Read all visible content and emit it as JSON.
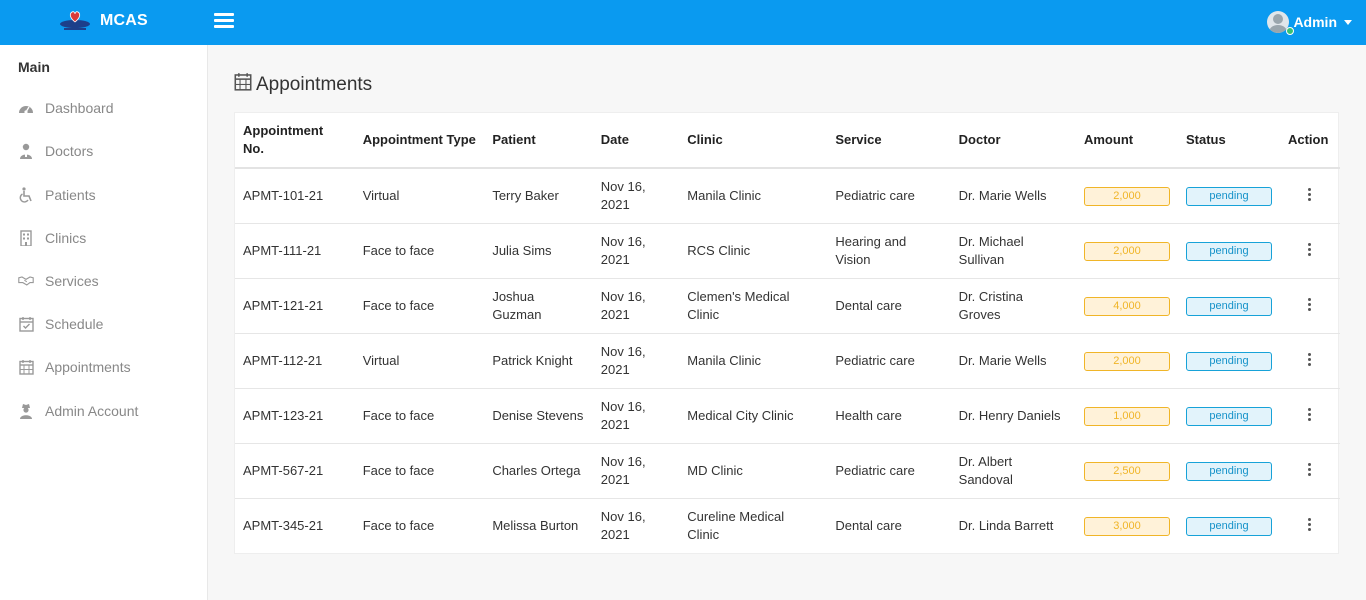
{
  "app": {
    "brand": "MCAS"
  },
  "user": {
    "name": "Admin"
  },
  "sidebar": {
    "heading": "Main",
    "items": [
      {
        "label": "Dashboard",
        "icon": "dashboard-icon"
      },
      {
        "label": "Doctors",
        "icon": "doctor-icon"
      },
      {
        "label": "Patients",
        "icon": "wheelchair-icon"
      },
      {
        "label": "Clinics",
        "icon": "building-icon"
      },
      {
        "label": "Services",
        "icon": "handshake-icon"
      },
      {
        "label": "Schedule",
        "icon": "calendar-check-icon"
      },
      {
        "label": "Appointments",
        "icon": "calendar-icon"
      },
      {
        "label": "Admin Account",
        "icon": "user-secret-icon"
      }
    ]
  },
  "page": {
    "title": "Appointments"
  },
  "table": {
    "headers": {
      "appointment_no": "Appointment No.",
      "appointment_type": "Appointment Type",
      "patient": "Patient",
      "date": "Date",
      "clinic": "Clinic",
      "service": "Service",
      "doctor": "Doctor",
      "amount": "Amount",
      "status": "Status",
      "action": "Action"
    },
    "rows": [
      {
        "appointment_no": "APMT-101-21",
        "appointment_type": "Virtual",
        "patient": "Terry Baker",
        "date": "Nov 16, 2021",
        "clinic": "Manila Clinic",
        "service": "Pediatric care",
        "doctor": "Dr. Marie Wells",
        "amount": "2,000",
        "status": "pending"
      },
      {
        "appointment_no": "APMT-111-21",
        "appointment_type": "Face to face",
        "patient": "Julia Sims",
        "date": "Nov 16, 2021",
        "clinic": "RCS Clinic",
        "service": "Hearing and Vision",
        "doctor": "Dr. Michael Sullivan",
        "amount": "2,000",
        "status": "pending"
      },
      {
        "appointment_no": "APMT-121-21",
        "appointment_type": "Face to face",
        "patient": "Joshua Guzman",
        "date": "Nov 16, 2021",
        "clinic": "Clemen's Medical Clinic",
        "service": "Dental care",
        "doctor": "Dr. Cristina Groves",
        "amount": "4,000",
        "status": "pending"
      },
      {
        "appointment_no": "APMT-112-21",
        "appointment_type": "Virtual",
        "patient": "Patrick Knight",
        "date": "Nov 16, 2021",
        "clinic": "Manila Clinic",
        "service": "Pediatric care",
        "doctor": "Dr. Marie Wells",
        "amount": "2,000",
        "status": "pending"
      },
      {
        "appointment_no": "APMT-123-21",
        "appointment_type": "Face to face",
        "patient": "Denise Stevens",
        "date": "Nov 16, 2021",
        "clinic": "Medical City Clinic",
        "service": "Health care",
        "doctor": "Dr. Henry Daniels",
        "amount": "1,000",
        "status": "pending"
      },
      {
        "appointment_no": "APMT-567-21",
        "appointment_type": "Face to face",
        "patient": "Charles Ortega",
        "date": "Nov 16, 2021",
        "clinic": "MD Clinic",
        "service": "Pediatric care",
        "doctor": "Dr. Albert Sandoval",
        "amount": "2,500",
        "status": "pending"
      },
      {
        "appointment_no": "APMT-345-21",
        "appointment_type": "Face to face",
        "patient": "Melissa Burton",
        "date": "Nov 16, 2021",
        "clinic": "Cureline Medical Clinic",
        "service": "Dental care",
        "doctor": "Dr. Linda Barrett",
        "amount": "3,000",
        "status": "pending"
      }
    ]
  },
  "colors": {
    "topbar": "#0a9af0",
    "amount_accent": "#f0b528",
    "status_accent": "#17a2d8"
  }
}
